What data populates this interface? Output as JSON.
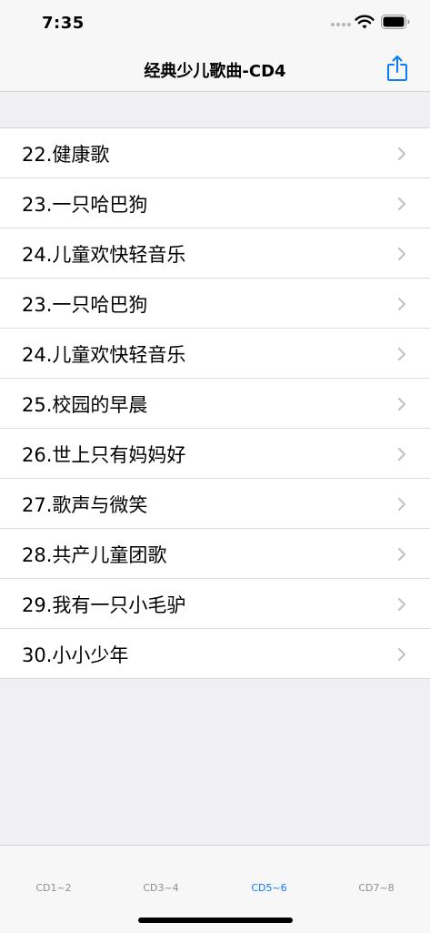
{
  "status_bar": {
    "time": "7:35"
  },
  "nav": {
    "title": "经典少儿歌曲-CD4",
    "share_icon": "share-icon"
  },
  "accent_color": "#0a7aff",
  "songs": [
    {
      "label": "22.健康歌"
    },
    {
      "label": "23.一只哈巴狗"
    },
    {
      "label": "24.儿童欢快轻音乐"
    },
    {
      "label": "23.一只哈巴狗"
    },
    {
      "label": "24.儿童欢快轻音乐"
    },
    {
      "label": "25.校园的早晨"
    },
    {
      "label": "26.世上只有妈妈好"
    },
    {
      "label": "27.歌声与微笑"
    },
    {
      "label": "28.共产儿童团歌"
    },
    {
      "label": "29.我有一只小毛驴"
    },
    {
      "label": "30.小小少年"
    }
  ],
  "tabs": [
    {
      "label": "CD1~2",
      "active": false
    },
    {
      "label": "CD3~4",
      "active": false
    },
    {
      "label": "CD5~6",
      "active": true
    },
    {
      "label": "CD7~8",
      "active": false
    }
  ]
}
